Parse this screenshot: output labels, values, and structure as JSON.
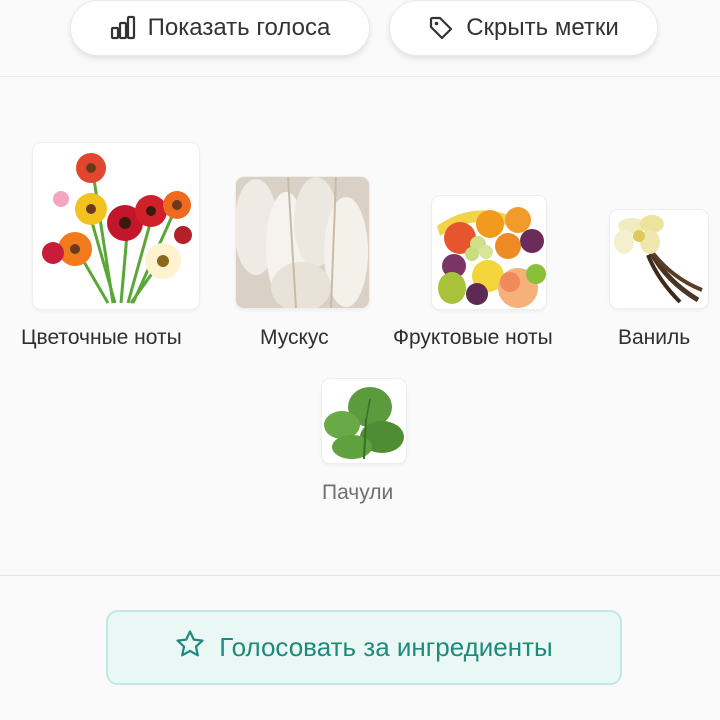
{
  "toolbar": {
    "show_votes_label": "Показать голоса",
    "hide_tags_label": "Скрыть метки"
  },
  "notes": [
    {
      "label": "Цветочные ноты",
      "icon": "flowers-image"
    },
    {
      "label": "Мускус",
      "icon": "musk-image"
    },
    {
      "label": "Фруктовые ноты",
      "icon": "fruits-image"
    },
    {
      "label": "Ваниль",
      "icon": "vanilla-image"
    },
    {
      "label": "Пачули",
      "icon": "patchouli-image"
    }
  ],
  "vote": {
    "label": "Голосовать за ингредиенты",
    "icon": "star-icon"
  },
  "colors": {
    "accent": "#1f8a7b",
    "accent_bg": "#eaf8f5",
    "accent_border": "#bfe9df"
  }
}
